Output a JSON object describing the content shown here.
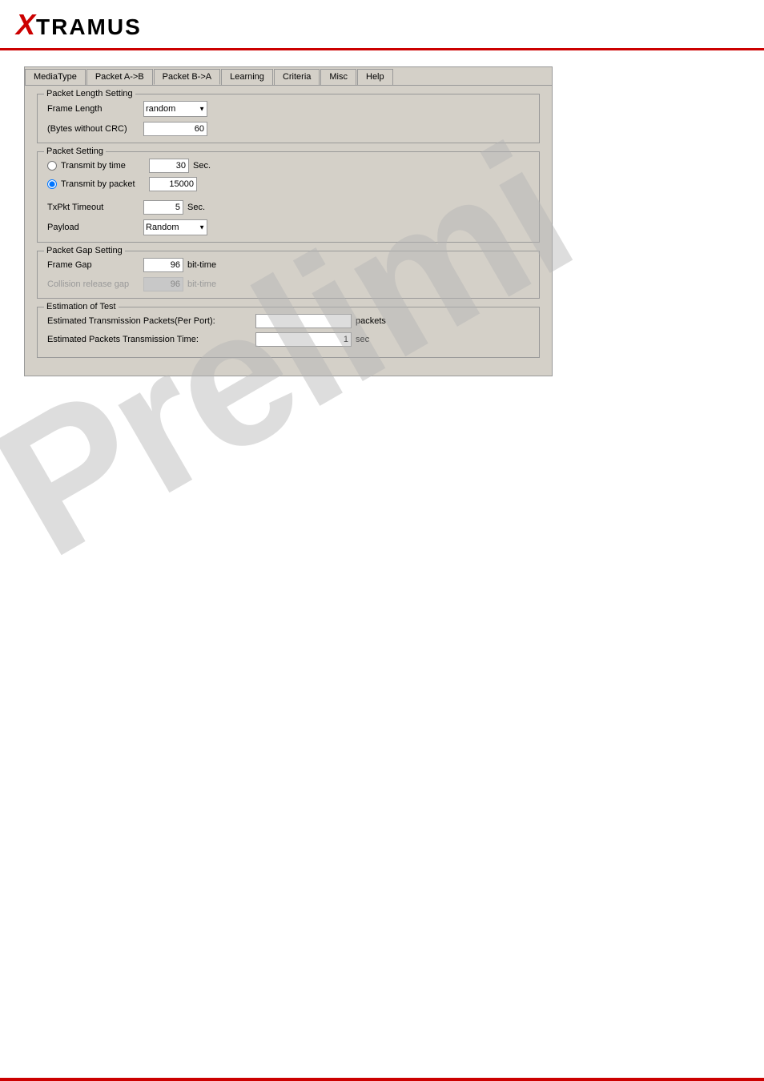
{
  "header": {
    "logo_x": "X",
    "logo_rest": "TRAMUS"
  },
  "tabs": {
    "items": [
      {
        "label": "MediaType",
        "active": false
      },
      {
        "label": "Packet A->B",
        "active": false
      },
      {
        "label": "Packet B->A",
        "active": true
      },
      {
        "label": "Learning",
        "active": false
      },
      {
        "label": "Criteria",
        "active": false
      },
      {
        "label": "Misc",
        "active": false
      },
      {
        "label": "Help",
        "active": false
      }
    ]
  },
  "packet_length_setting": {
    "title": "Packet Length Setting",
    "frame_length_label": "Frame Length",
    "frame_length_value": "random",
    "bytes_label": "(Bytes without CRC)",
    "bytes_value": "60"
  },
  "packet_setting": {
    "title": "Packet Setting",
    "transmit_by_time_label": "Transmit by time",
    "transmit_by_time_value": "30",
    "transmit_by_time_unit": "Sec.",
    "transmit_by_packet_label": "Transmit by packet",
    "transmit_by_packet_value": "15000",
    "txpkt_timeout_label": "TxPkt Timeout",
    "txpkt_timeout_value": "5",
    "txpkt_timeout_unit": "Sec.",
    "payload_label": "Payload",
    "payload_value": "Random"
  },
  "packet_gap_setting": {
    "title": "Packet Gap Setting",
    "frame_gap_label": "Frame Gap",
    "frame_gap_value": "96",
    "frame_gap_unit": "bit-time",
    "collision_label": "Collision release gap",
    "collision_value": "96",
    "collision_unit": "bit-time"
  },
  "estimation": {
    "title": "Estimation of Test",
    "transmission_label": "Estimated Transmission Packets(Per Port):",
    "transmission_value": "",
    "transmission_unit": "packets",
    "time_label": "Estimated Packets Transmission Time:",
    "time_value": "1",
    "time_unit": "sec"
  },
  "watermark": "Prelimi",
  "footer_color": "#cc0000"
}
